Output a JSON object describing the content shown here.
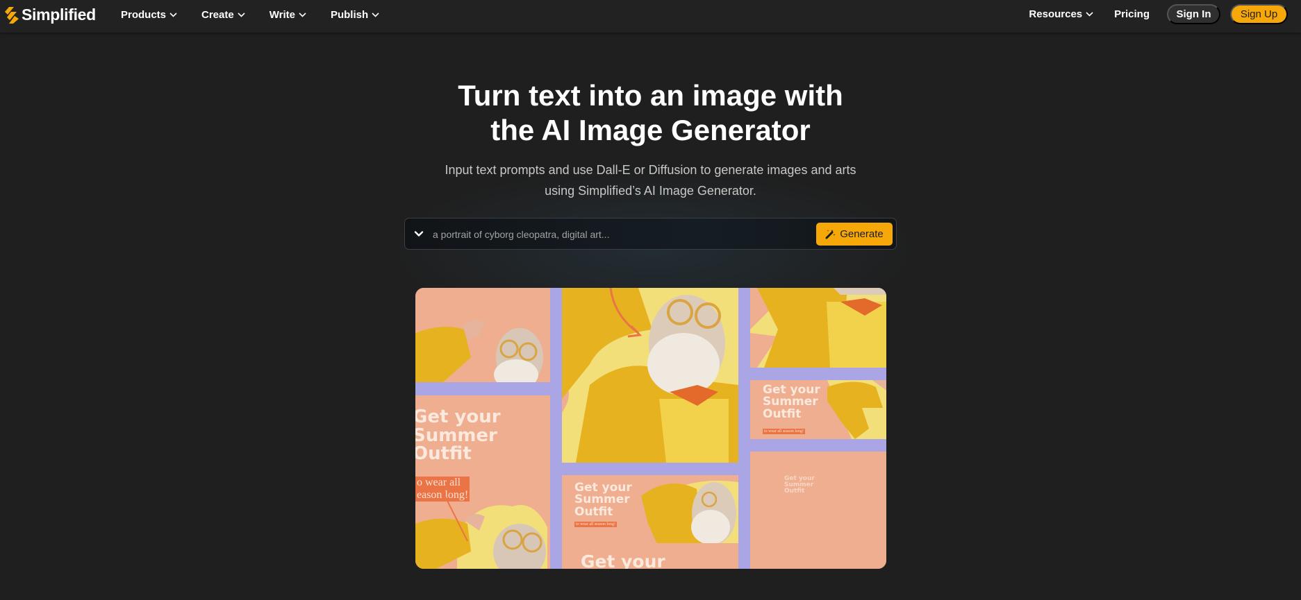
{
  "nav": {
    "brand": "Simplified",
    "menu": [
      {
        "label": "Products",
        "icon": "chevron-down-icon"
      },
      {
        "label": "Create",
        "icon": "chevron-down-icon"
      },
      {
        "label": "Write",
        "icon": "chevron-down-icon"
      },
      {
        "label": "Publish",
        "icon": "chevron-down-icon"
      }
    ],
    "resources": {
      "label": "Resources",
      "icon": "chevron-down-icon"
    },
    "pricing": "Pricing",
    "sign_in": "Sign In",
    "sign_up": "Sign Up"
  },
  "colors": {
    "accent": "#f6a809",
    "background": "#1f1f1f",
    "nav_background": "#222222",
    "tile_peach": "#eeae8f",
    "tile_lavender": "#aaa6e6",
    "tile_yellow": "#f3df7a",
    "tag_orange": "#ea7445"
  },
  "hero": {
    "title_line1": "Turn text into an image with",
    "title_line2": "the AI Image Generator",
    "subtitle_line1": "Input text prompts and use Dall-E or Diffusion to generate images and arts",
    "subtitle_line2": "using Simplified’s AI Image Generator."
  },
  "prompt": {
    "toggle_icon": "chevron-down-icon",
    "value": "",
    "placeholder": "a portrait of cyborg cleopatra, digital art...",
    "generate_label": "Generate",
    "generate_icon": "magic-wand-icon"
  },
  "showcase": {
    "promo_line1": "Get your",
    "promo_line2": "Summer",
    "promo_line3": "Outfit",
    "tag_line1": "o wear all",
    "tag_line2": "eason long!",
    "tag_small": "to wear all season long!",
    "bottom_partial": "Get your"
  }
}
